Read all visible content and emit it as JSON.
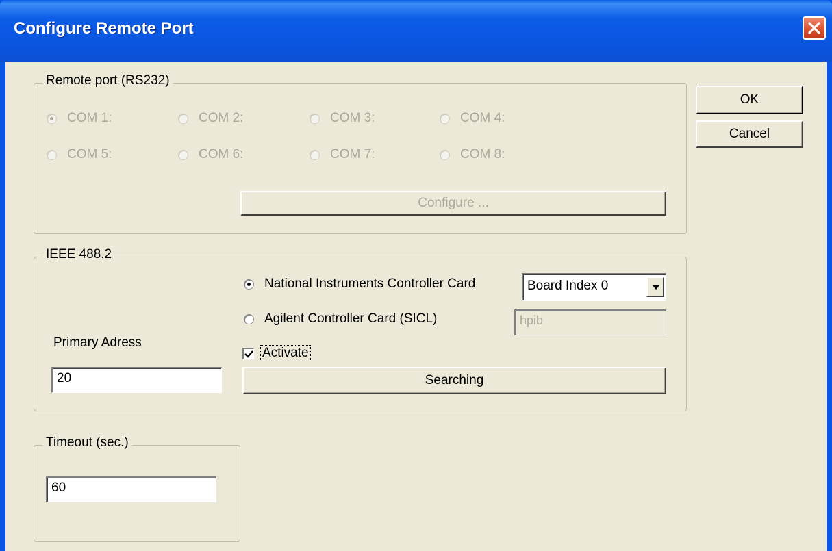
{
  "window": {
    "title": "Configure Remote Port"
  },
  "buttons": {
    "ok": "OK",
    "cancel": "Cancel"
  },
  "rs232": {
    "legend": "Remote port (RS232)",
    "ports": [
      "COM 1:",
      "COM 2:",
      "COM 3:",
      "COM 4:",
      "COM 5:",
      "COM 6:",
      "COM 7:",
      "COM 8:"
    ],
    "selected": "COM 1:",
    "configure_label": "Configure ..."
  },
  "ieee": {
    "legend": "IEEE 488.2",
    "ni_label": "National Instruments Controller Card",
    "agilent_label": "Agilent Controller Card (SICL)",
    "board_index": "Board Index 0",
    "sicl_name": "hpib",
    "primary_label": "Primary Adress",
    "primary_value": "20",
    "activate_label": "Activate",
    "activate_checked": true,
    "searching_label": "Searching"
  },
  "timeout": {
    "legend": "Timeout (sec.)",
    "value": "60"
  },
  "colors": {
    "titlebar": "#0a56e0",
    "dialog_bg": "#ece9d8",
    "disabled_text": "#aca899",
    "close_button": "#d9532f"
  }
}
